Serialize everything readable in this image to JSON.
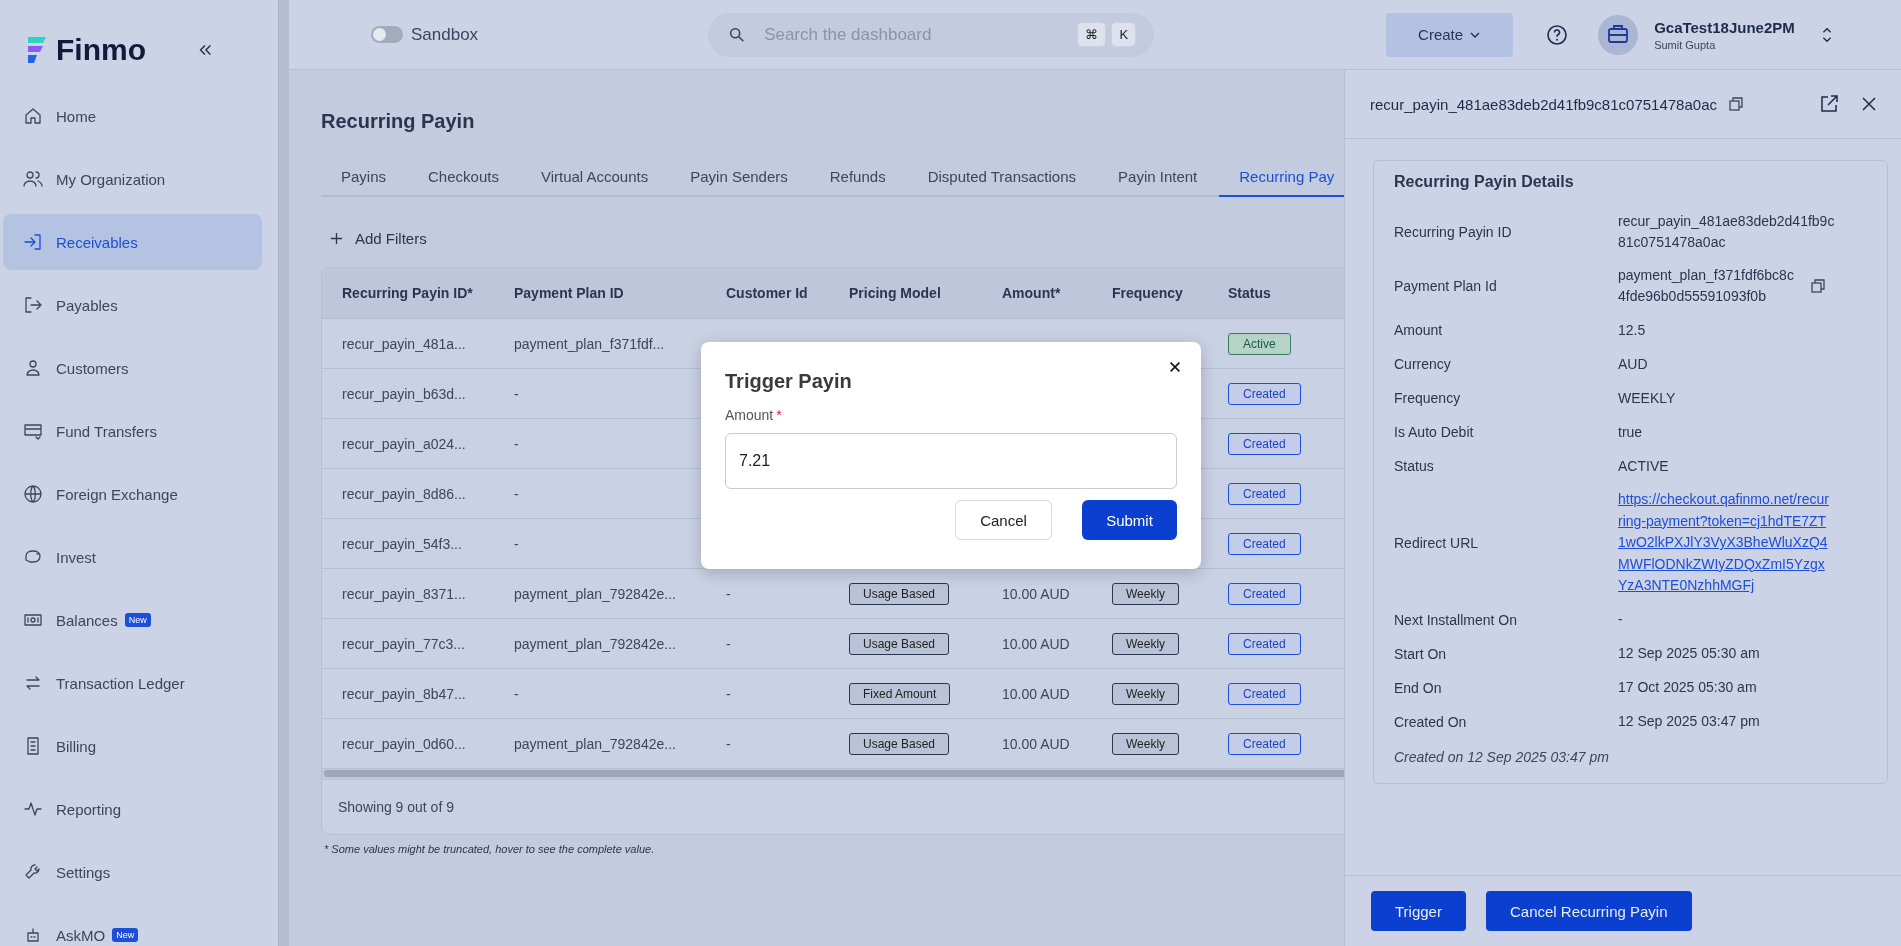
{
  "sidebar": {
    "logo": "Finmo",
    "items": [
      {
        "label": "Home",
        "selected": false
      },
      {
        "label": "My Organization",
        "selected": false
      },
      {
        "label": "Receivables",
        "selected": true
      },
      {
        "label": "Payables",
        "selected": false
      },
      {
        "label": "Customers",
        "selected": false
      },
      {
        "label": "Fund Transfers",
        "selected": false
      },
      {
        "label": "Foreign Exchange",
        "selected": false
      },
      {
        "label": "Invest",
        "selected": false
      },
      {
        "label": "Balances",
        "selected": false,
        "badge": "New"
      },
      {
        "label": "Transaction Ledger",
        "selected": false
      },
      {
        "label": "Billing",
        "selected": false
      },
      {
        "label": "Reporting",
        "selected": false
      },
      {
        "label": "Settings",
        "selected": false
      },
      {
        "label": "AskMO",
        "selected": false,
        "badge": "New"
      }
    ]
  },
  "topbar": {
    "sandbox": {
      "label": "Sandbox",
      "on": false
    },
    "search": {
      "placeholder": "Search the dashboard",
      "keys": [
        "⌘",
        "K"
      ]
    },
    "create": "Create",
    "org": {
      "name": "GcaTest18June2PM",
      "user": "Sumit Gupta"
    }
  },
  "page": {
    "title": "Recurring Payin",
    "tabs": [
      {
        "label": "Payins",
        "selected": false
      },
      {
        "label": "Checkouts",
        "selected": false
      },
      {
        "label": "Virtual Accounts",
        "selected": false
      },
      {
        "label": "Payin Senders",
        "selected": false
      },
      {
        "label": "Refunds",
        "selected": false
      },
      {
        "label": "Disputed Transactions",
        "selected": false
      },
      {
        "label": "Payin Intent",
        "selected": false
      },
      {
        "label": "Recurring Pay",
        "selected": true
      }
    ],
    "add_filters": "Add Filters"
  },
  "table": {
    "columns": [
      "Recurring Payin ID*",
      "Payment Plan ID",
      "Customer Id",
      "Pricing Model",
      "Amount*",
      "Frequency",
      "Status"
    ],
    "rows": [
      {
        "id": "recur_payin_481a...",
        "plan": "payment_plan_f371fdf...",
        "status": {
          "label": "Active",
          "kind": "active"
        }
      },
      {
        "id": "recur_payin_b63d...",
        "plan": "-",
        "status": {
          "label": "Created",
          "kind": "created"
        }
      },
      {
        "id": "recur_payin_a024...",
        "plan": "-",
        "status": {
          "label": "Created",
          "kind": "created"
        }
      },
      {
        "id": "recur_payin_8d86...",
        "plan": "-",
        "status": {
          "label": "Created",
          "kind": "created"
        }
      },
      {
        "id": "recur_payin_54f3...",
        "plan": "-",
        "status": {
          "label": "Created",
          "kind": "created"
        }
      },
      {
        "id": "recur_payin_8371...",
        "plan": "payment_plan_792842e...",
        "customer": "-",
        "pricing": "Usage Based",
        "amount": "10.00 AUD",
        "frequency": "Weekly",
        "status": {
          "label": "Created",
          "kind": "created"
        }
      },
      {
        "id": "recur_payin_77c3...",
        "plan": "payment_plan_792842e...",
        "customer": "-",
        "pricing": "Usage Based",
        "amount": "10.00 AUD",
        "frequency": "Weekly",
        "status": {
          "label": "Created",
          "kind": "created"
        }
      },
      {
        "id": "recur_payin_8b47...",
        "plan": "-",
        "customer": "-",
        "pricing": "Fixed Amount",
        "amount": "10.00 AUD",
        "frequency": "Weekly",
        "status": {
          "label": "Created",
          "kind": "created"
        }
      },
      {
        "id": "recur_payin_0d60...",
        "plan": "payment_plan_792842e...",
        "customer": "-",
        "pricing": "Usage Based",
        "amount": "10.00 AUD",
        "frequency": "Weekly",
        "status": {
          "label": "Created",
          "kind": "created"
        }
      }
    ],
    "footer": "Showing 9 out of 9",
    "note": "* Some values might be truncated, hover to see the complete value."
  },
  "drawer": {
    "title": "recur_payin_481ae83deb2d41fb9c81c0751478a0ac",
    "section": "Recurring Payin Details",
    "fields": [
      {
        "label": "Recurring Payin ID",
        "value": "recur_payin_481ae83deb2d41fb9c81c0751478a0ac",
        "kind": "text"
      },
      {
        "label": "Payment Plan Id",
        "value": "payment_plan_f371fdf6bc8c4fde96b0d55591093f0b",
        "kind": "copy"
      },
      {
        "label": "Amount",
        "value": "12.5",
        "kind": "text"
      },
      {
        "label": "Currency",
        "value": "AUD",
        "kind": "text"
      },
      {
        "label": "Frequency",
        "value": "WEEKLY",
        "kind": "text"
      },
      {
        "label": "Is Auto Debit",
        "value": "true",
        "kind": "text"
      },
      {
        "label": "Status",
        "value": "ACTIVE",
        "kind": "text"
      },
      {
        "label": "Redirect URL",
        "value": "https://checkout.qafinmo.net/recurring-payment?token=cj1hdTE7ZT1wO2lkPXJlY3VyX3BheWluXzQ4MWFlODNkZWIyZDQxZmI5YzgxYzA3NTE0NzhhMGFj",
        "kind": "link"
      },
      {
        "label": "Next Installment On",
        "value": "-",
        "kind": "text"
      },
      {
        "label": "Start On",
        "value": "12 Sep 2025 05:30 am",
        "kind": "text"
      },
      {
        "label": "End On",
        "value": "17 Oct 2025 05:30 am",
        "kind": "text"
      },
      {
        "label": "Created On",
        "value": "12 Sep 2025 03:47 pm",
        "kind": "text"
      }
    ],
    "created_note": "Created on 12 Sep 2025 03:47 pm",
    "buttons": [
      "Trigger",
      "Cancel Recurring Payin"
    ]
  },
  "modal": {
    "title": "Trigger Payin",
    "field": {
      "label": "Amount",
      "required_mark": "*",
      "value": "7.21"
    },
    "buttons": [
      "Cancel",
      "Submit"
    ]
  }
}
